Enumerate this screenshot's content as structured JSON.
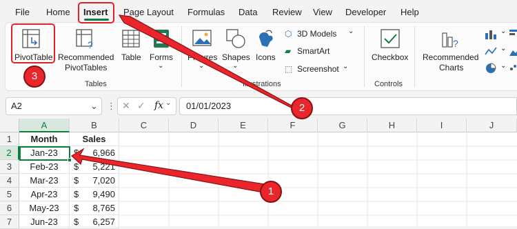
{
  "menu": {
    "tabs": [
      {
        "label": "File"
      },
      {
        "label": "Home"
      },
      {
        "label": "Insert"
      },
      {
        "label": "Page Layout"
      },
      {
        "label": "Formulas"
      },
      {
        "label": "Data"
      },
      {
        "label": "Review"
      },
      {
        "label": "View"
      },
      {
        "label": "Developer"
      },
      {
        "label": "Help"
      }
    ],
    "active_tab": "Insert"
  },
  "ribbon": {
    "tables": {
      "pivot_table": "PivotTable",
      "recommended_1": "Recommended",
      "recommended_2": "PivotTables",
      "table": "Table",
      "forms": "Forms",
      "group_label": "Tables"
    },
    "illustrations": {
      "pictures": "Pictures",
      "shapes": "Shapes",
      "icons": "Icons",
      "models_3d": "3D Models",
      "smartart": "SmartArt",
      "screenshot": "Screenshot",
      "group_label": "Illustrations"
    },
    "controls": {
      "checkbox": "Checkbox",
      "group_label": "Controls"
    },
    "charts": {
      "recommended_1": "Recommended",
      "recommended_2": "Charts"
    }
  },
  "formula_bar": {
    "name_box": "A2",
    "fx": "fx",
    "value": "01/01/2023"
  },
  "sheet": {
    "columns": [
      "A",
      "B",
      "C",
      "D",
      "E",
      "F",
      "G",
      "H",
      "I",
      "J"
    ],
    "rows": [
      "1",
      "2",
      "3",
      "4",
      "5",
      "6"
    ],
    "header": {
      "month": "Month",
      "sales": "Sales"
    },
    "data": [
      {
        "month": "Jan-23",
        "currency": "$",
        "sales": "6,966"
      },
      {
        "month": "Feb-23",
        "currency": "$",
        "sales": "5,221"
      },
      {
        "month": "Mar-23",
        "currency": "$",
        "sales": "7,020"
      },
      {
        "month": "Apr-23",
        "currency": "$",
        "sales": "9,490"
      },
      {
        "month": "May-23",
        "currency": "$",
        "sales": "8,765"
      },
      {
        "month": "Jun-23",
        "currency": "$",
        "sales": "6,257"
      }
    ]
  },
  "annotations": {
    "step1": "1",
    "step2": "2",
    "step3": "3",
    "color": "#e8262b"
  }
}
